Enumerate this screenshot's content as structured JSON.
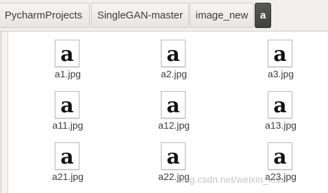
{
  "breadcrumb": {
    "items": [
      {
        "label": "PycharmProjects"
      },
      {
        "label": "SingleGAN-master"
      },
      {
        "label": "image_new"
      },
      {
        "label": "a"
      }
    ]
  },
  "files": [
    {
      "name": "a1.jpg"
    },
    {
      "name": "a2.jpg"
    },
    {
      "name": "a3.jpg"
    },
    {
      "name": "a11.jpg"
    },
    {
      "name": "a12.jpg"
    },
    {
      "name": "a13.jpg"
    },
    {
      "name": "a21.jpg"
    },
    {
      "name": "a22.jpg"
    },
    {
      "name": "a23.jpg"
    }
  ],
  "watermark": {
    "text": "blog.csdn.net/weixin_kiss"
  },
  "thumbnail_glyph": "a"
}
